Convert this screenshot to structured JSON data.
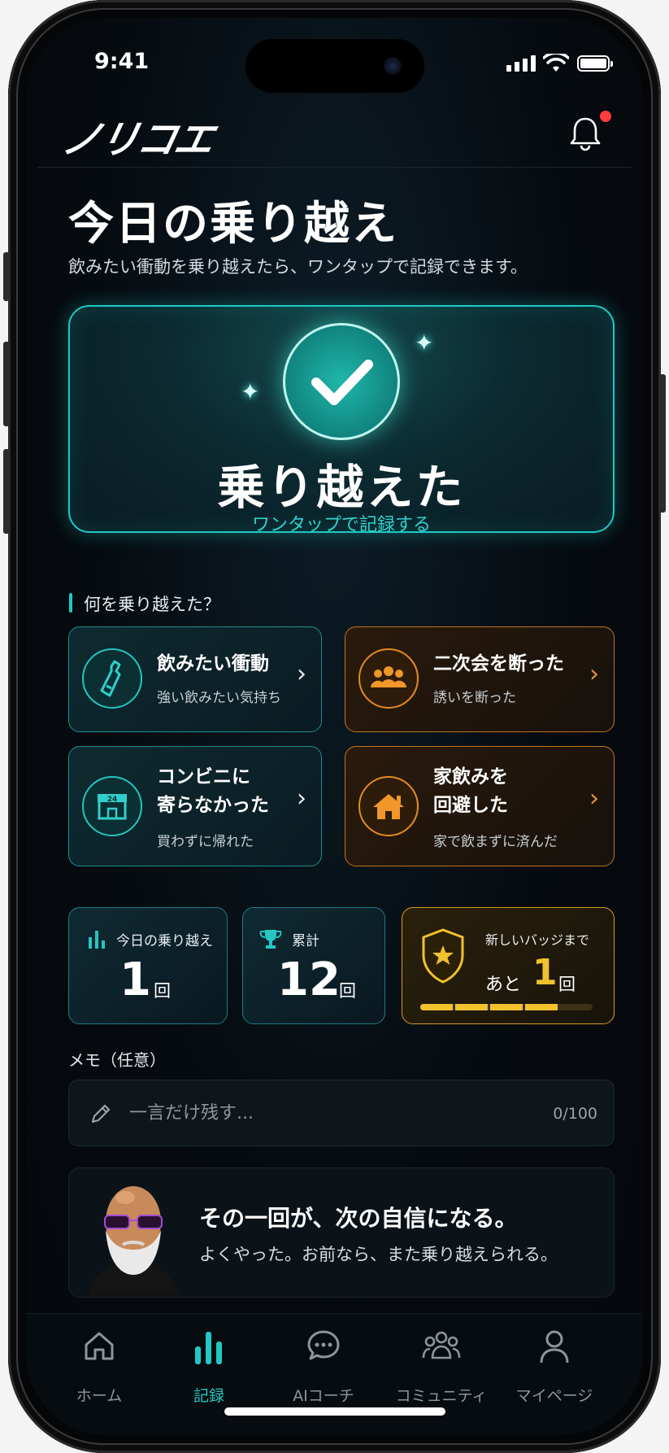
{
  "status_bar": {
    "time": "9:41"
  },
  "header": {
    "logo": "ノリコエ"
  },
  "page": {
    "title": "今日の乗り越え",
    "subtitle": "飲みたい衝動を乗り越えたら、ワンタップで記録できます。"
  },
  "hero": {
    "label": "乗り越えた",
    "sub": "ワンタップで記録する"
  },
  "section": {
    "label": "何を乗り越えた？"
  },
  "cards": [
    {
      "title_line1": "飲みたい衝動",
      "title_line2": "",
      "sub": "強い飲みたい気持ち",
      "icon": "bottle-icon"
    },
    {
      "title_line1": "二次会を断った",
      "title_line2": "",
      "sub": "誘いを断った",
      "icon": "group-icon"
    },
    {
      "title_line1": "コンビニに",
      "title_line2": "寄らなかった",
      "sub": "買わずに帰れた",
      "icon": "convenience-store-icon",
      "icon_badge": "24"
    },
    {
      "title_line1": "家飲みを",
      "title_line2": "回避した",
      "sub": "家で飲まずに済んだ",
      "icon": "house-icon"
    }
  ],
  "stats": {
    "today": {
      "label": "今日の乗り越え",
      "value": "1",
      "unit": "回"
    },
    "total": {
      "label": "累計",
      "value": "12",
      "unit": "回"
    },
    "badge": {
      "label": "新しいバッジまで",
      "prefix": "あと",
      "value": "1",
      "unit": "回",
      "progress_segments_filled": 4,
      "progress_segments_total": 5
    }
  },
  "memo": {
    "label": "メモ（任意）",
    "placeholder": "一言だけ残す...",
    "value": "",
    "counter": "0/100"
  },
  "coach": {
    "title": "その一回が、次の自信になる。",
    "message": "よくやった。お前なら、また乗り越えられる。"
  },
  "tabs": [
    {
      "label": "ホーム",
      "icon": "home-icon",
      "active": false
    },
    {
      "label": "記録",
      "icon": "record-chart-icon",
      "active": true
    },
    {
      "label": "AIコーチ",
      "icon": "chat-bubble-icon",
      "active": false
    },
    {
      "label": "コミュニティ",
      "icon": "community-icon",
      "active": false
    },
    {
      "label": "マイページ",
      "icon": "person-icon",
      "active": false
    }
  ],
  "colors": {
    "accent_teal": "#1ec9c3",
    "accent_orange": "#e48a21",
    "accent_gold": "#f1c12e",
    "notification_dot": "#ff3b3b"
  }
}
